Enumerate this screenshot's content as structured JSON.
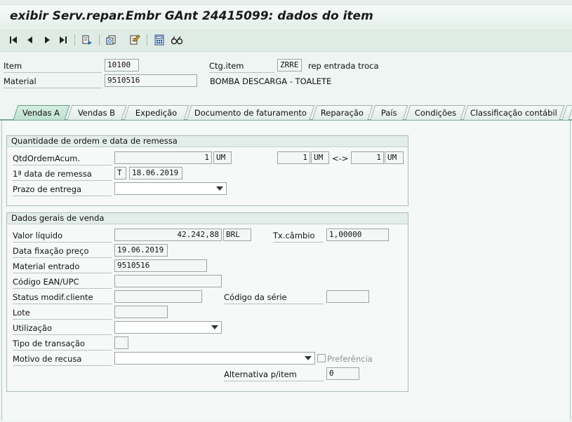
{
  "title": "exibir Serv.repar.Embr GAnt 24415099: dados do item",
  "header": {
    "item_label": "Item",
    "item_value": "10100",
    "material_label": "Material",
    "material_value": "9510516",
    "ctg_label": "Ctg.item",
    "ctg_value": "ZRRE",
    "ctg_desc": "rep entrada troca",
    "material_desc": "BOMBA DESCARGA - TOALETE"
  },
  "tabs": [
    "Vendas A",
    "Vendas B",
    "Expedição",
    "Documento de faturamento",
    "Reparação",
    "País",
    "Condições",
    "Classificação contábil"
  ],
  "group1": {
    "title": "Quantidade de ordem e data de remessa",
    "qtd_label": "QtdOrdemAcum.",
    "qtd_value": "1",
    "qtd_unit": "UM",
    "conv_left_value": "1",
    "conv_left_unit": "UM",
    "conv_arrow": "<->",
    "conv_right_value": "1",
    "conv_right_unit": "UM",
    "remessa_label": "1ª data de remessa",
    "remessa_type": "T",
    "remessa_date": "18.06.2019",
    "prazo_label": "Prazo de entrega",
    "prazo_value": ""
  },
  "group2": {
    "title": "Dados gerais de venda",
    "valor_label": "Valor líquido",
    "valor_value": "42.242,88",
    "valor_currency": "BRL",
    "cambio_label": "Tx.câmbio",
    "cambio_value": "1,00000",
    "fixacao_label": "Data fixação preço",
    "fixacao_value": "19.06.2019",
    "mat_entrado_label": "Material entrado",
    "mat_entrado_value": "9510516",
    "ean_label": "Código EAN/UPC",
    "ean_value": "",
    "status_label": "Status modif.cliente",
    "status_value": "",
    "serie_label": "Código da série",
    "serie_value": "",
    "lote_label": "Lote",
    "lote_value": "",
    "utilizacao_label": "Utilização",
    "utilizacao_value": "",
    "transacao_label": "Tipo de transação",
    "transacao_value": "",
    "recusa_label": "Motivo de recusa",
    "recusa_value": "",
    "preferencia_label": "Preferência",
    "alternativa_label": "Alternativa p/item",
    "alternativa_value": "0"
  },
  "toolbar_icons": [
    "first-item-icon",
    "previous-item-icon",
    "next-item-icon",
    "last-item-icon",
    "document-flow-icon",
    "header-icon",
    "edit-icon",
    "calculator-icon",
    "glasses-icon"
  ]
}
